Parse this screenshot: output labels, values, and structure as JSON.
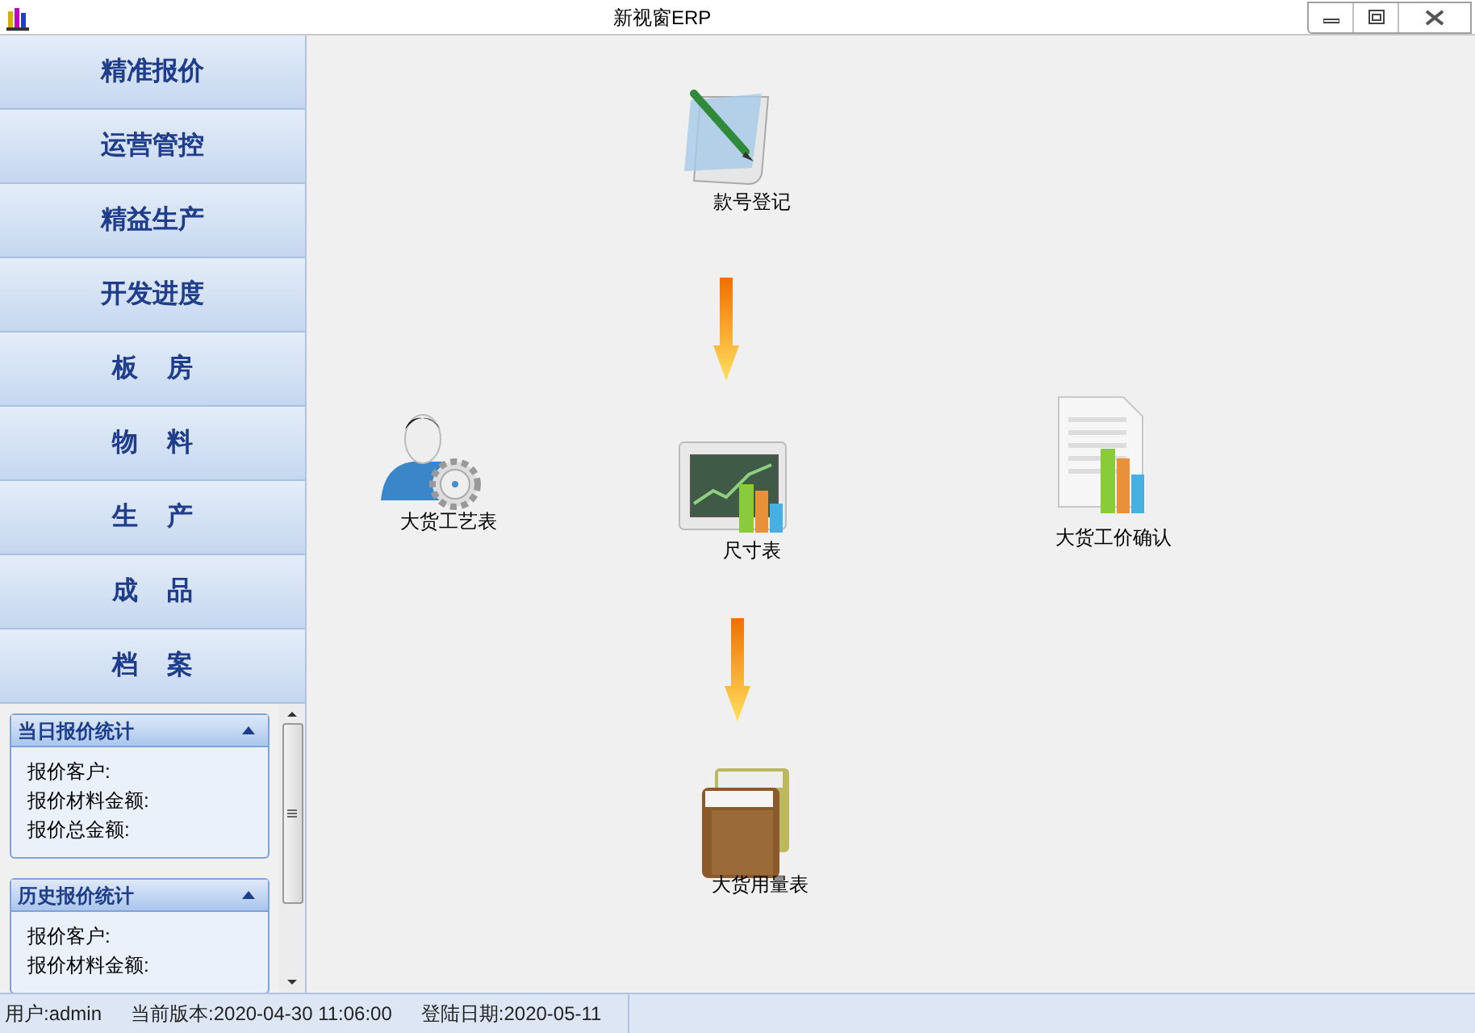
{
  "window": {
    "title": "新视窗ERP"
  },
  "nav": [
    {
      "label": "精准报价"
    },
    {
      "label": "运营管控"
    },
    {
      "label": "精益生产"
    },
    {
      "label": "开发进度"
    },
    {
      "label": "板    房"
    },
    {
      "label": "物    料"
    },
    {
      "label": "生    产"
    },
    {
      "label": "成    品"
    },
    {
      "label": "档    案"
    }
  ],
  "stats_panels": [
    {
      "title": "当日报价统计",
      "expanded": true,
      "lines": [
        "报价客户:",
        "报价材料金额:",
        "报价总金额:"
      ]
    },
    {
      "title": "历史报价统计",
      "expanded": true,
      "lines": [
        "报价客户:",
        "报价材料金额:"
      ]
    }
  ],
  "canvas_nodes": [
    {
      "kind": "notepad",
      "label": "款号登记"
    },
    {
      "kind": "person",
      "label": "大货工艺表"
    },
    {
      "kind": "monitor",
      "label": "尺寸表"
    },
    {
      "kind": "document",
      "label": "大货工价确认"
    },
    {
      "kind": "books",
      "label": "大货用量表"
    }
  ],
  "status_bar": {
    "user": "用户:admin",
    "version": "当前版本:2020-04-30 11:06:00",
    "login_date": "登陆日期:2020-05-11"
  }
}
